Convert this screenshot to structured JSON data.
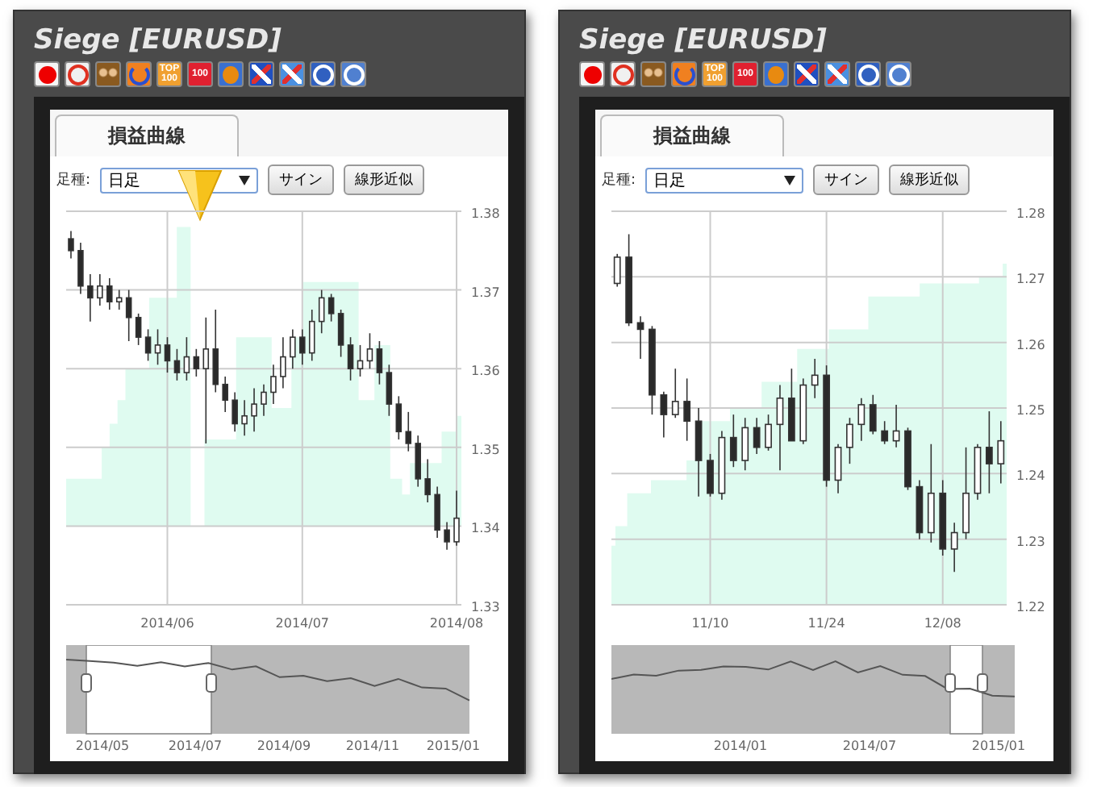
{
  "panels": [
    {
      "title": "Siege [EURUSD]",
      "pointer_marker": true,
      "icons": [
        {
          "kind": "red-dot"
        },
        {
          "kind": "swirl"
        },
        {
          "kind": "people"
        },
        {
          "kind": "arrow"
        },
        {
          "kind": "top",
          "label": "TOP 100"
        },
        {
          "kind": "t100",
          "label": "100"
        },
        {
          "kind": "egg"
        },
        {
          "kind": "network"
        },
        {
          "kind": "leaf"
        },
        {
          "kind": "gauge"
        },
        {
          "kind": "globe"
        }
      ],
      "tabs": [
        {
          "label": "損益曲線",
          "selected": true
        }
      ],
      "timeframe": {
        "label": "足種:",
        "value": "日足"
      },
      "buttons": [
        "サイン",
        "線形近似"
      ],
      "chart_data": {
        "type": "candlestick",
        "categories": [
          null,
          null,
          null,
          null,
          null,
          null,
          null,
          null,
          null,
          null,
          "2014/06",
          null,
          null,
          null,
          null,
          null,
          null,
          null,
          null,
          null,
          null,
          null,
          null,
          null,
          "2014/07",
          null,
          null,
          null,
          null,
          null,
          null,
          null,
          null,
          null,
          null,
          null,
          null,
          null,
          null,
          null,
          "2014/08"
        ],
        "ohlc": [
          [
            1.3765,
            1.3775,
            1.374,
            1.375
          ],
          [
            1.375,
            1.376,
            1.3695,
            1.3705
          ],
          [
            1.3705,
            1.372,
            1.366,
            1.369
          ],
          [
            1.369,
            1.372,
            1.368,
            1.3705
          ],
          [
            1.3705,
            1.3715,
            1.3675,
            1.3685
          ],
          [
            1.3685,
            1.37,
            1.3675,
            1.369
          ],
          [
            1.369,
            1.37,
            1.3635,
            1.3665
          ],
          [
            1.3665,
            1.367,
            1.363,
            1.364
          ],
          [
            1.364,
            1.365,
            1.361,
            1.362
          ],
          [
            1.362,
            1.365,
            1.3605,
            1.363
          ],
          [
            1.363,
            1.364,
            1.3595,
            1.361
          ],
          [
            1.361,
            1.3625,
            1.3585,
            1.3595
          ],
          [
            1.3595,
            1.364,
            1.3585,
            1.3615
          ],
          [
            1.3615,
            1.3625,
            1.359,
            1.36
          ],
          [
            1.36,
            1.3665,
            1.3505,
            1.3625
          ],
          [
            1.3625,
            1.3675,
            1.357,
            1.358
          ],
          [
            1.358,
            1.359,
            1.3545,
            1.356
          ],
          [
            1.356,
            1.357,
            1.352,
            1.353
          ],
          [
            1.353,
            1.356,
            1.3515,
            1.354
          ],
          [
            1.354,
            1.3575,
            1.352,
            1.3555
          ],
          [
            1.3555,
            1.358,
            1.354,
            1.357
          ],
          [
            1.357,
            1.3605,
            1.3555,
            1.359
          ],
          [
            1.359,
            1.364,
            1.3575,
            1.3615
          ],
          [
            1.3615,
            1.365,
            1.36,
            1.364
          ],
          [
            1.364,
            1.365,
            1.3605,
            1.362
          ],
          [
            1.362,
            1.3675,
            1.361,
            1.366
          ],
          [
            1.366,
            1.37,
            1.3645,
            1.369
          ],
          [
            1.369,
            1.3695,
            1.366,
            1.367
          ],
          [
            1.367,
            1.3675,
            1.3615,
            1.363
          ],
          [
            1.363,
            1.364,
            1.3585,
            1.36
          ],
          [
            1.36,
            1.363,
            1.359,
            1.361
          ],
          [
            1.361,
            1.3645,
            1.36,
            1.3625
          ],
          [
            1.3625,
            1.3635,
            1.358,
            1.3595
          ],
          [
            1.3595,
            1.3605,
            1.354,
            1.3555
          ],
          [
            1.3555,
            1.3565,
            1.351,
            1.352
          ],
          [
            1.352,
            1.3545,
            1.3495,
            1.3505
          ],
          [
            1.3505,
            1.3515,
            1.345,
            1.346
          ],
          [
            1.346,
            1.3485,
            1.343,
            1.344
          ],
          [
            1.344,
            1.345,
            1.3385,
            1.3395
          ],
          [
            1.3395,
            1.3405,
            1.337,
            1.338
          ],
          [
            1.338,
            1.3445,
            1.3375,
            1.341
          ]
        ],
        "ylim": [
          1.33,
          1.38
        ],
        "grid": true,
        "yticks": [
          {
            "value": 1.38,
            "label": "1.38"
          },
          {
            "value": 1.37,
            "label": "1.37"
          },
          {
            "value": 1.36,
            "label": "1.36"
          },
          {
            "value": 1.35,
            "label": "1.35"
          },
          {
            "value": 1.34,
            "label": "1.34"
          },
          {
            "value": 1.33,
            "label": "1.33"
          }
        ]
      },
      "navigator_labels": [
        "2014/05",
        "2014/07",
        "2014/09",
        "2014/11",
        "2015/01"
      ]
    },
    {
      "title": "Siege [EURUSD]",
      "icons": [
        {
          "kind": "smile"
        },
        {
          "kind": "swirl"
        },
        {
          "kind": "people"
        },
        {
          "kind": "arrow"
        },
        {
          "kind": "top",
          "label": "TOP 100"
        },
        {
          "kind": "t100",
          "label": "100"
        },
        {
          "kind": "egg"
        },
        {
          "kind": "network"
        },
        {
          "kind": "leaf"
        },
        {
          "kind": "gauge"
        },
        {
          "kind": "globe"
        }
      ],
      "tabs": [
        {
          "label": "損益曲線",
          "selected": true
        }
      ],
      "timeframe": {
        "label": "足種:",
        "value": "日足"
      },
      "buttons": [
        "サイン",
        "線形近似"
      ],
      "chart_data": {
        "type": "candlestick",
        "categories": [
          null,
          null,
          null,
          null,
          null,
          null,
          null,
          null,
          "11/10",
          null,
          null,
          null,
          null,
          null,
          null,
          null,
          null,
          null,
          "11/24",
          null,
          null,
          null,
          null,
          null,
          null,
          null,
          null,
          null,
          "12/08",
          null,
          null,
          null,
          null,
          null
        ],
        "ohlc": [
          [
            1.269,
            1.2735,
            1.2685,
            1.273
          ],
          [
            1.273,
            1.2765,
            1.2625,
            1.263
          ],
          [
            1.263,
            1.264,
            1.2575,
            1.262
          ],
          [
            1.262,
            1.2625,
            1.249,
            1.252
          ],
          [
            1.252,
            1.2525,
            1.2455,
            1.249
          ],
          [
            1.249,
            1.256,
            1.2485,
            1.251
          ],
          [
            1.251,
            1.2545,
            1.245,
            1.248
          ],
          [
            1.248,
            1.25,
            1.2365,
            1.242
          ],
          [
            1.242,
            1.243,
            1.2365,
            1.237
          ],
          [
            1.237,
            1.2465,
            1.236,
            1.2455
          ],
          [
            1.2455,
            1.249,
            1.241,
            1.242
          ],
          [
            1.242,
            1.2485,
            1.2405,
            1.247
          ],
          [
            1.247,
            1.2485,
            1.243,
            1.244
          ],
          [
            1.244,
            1.249,
            1.2435,
            1.2475
          ],
          [
            1.2475,
            1.2535,
            1.2405,
            1.2515
          ],
          [
            1.2515,
            1.256,
            1.245,
            1.245
          ],
          [
            1.245,
            1.2545,
            1.2445,
            1.2535
          ],
          [
            1.2535,
            1.2575,
            1.2515,
            1.255
          ],
          [
            1.255,
            1.2565,
            1.238,
            1.239
          ],
          [
            1.239,
            1.2445,
            1.237,
            1.244
          ],
          [
            1.244,
            1.2485,
            1.2415,
            1.2475
          ],
          [
            1.2475,
            1.2515,
            1.245,
            1.2505
          ],
          [
            1.2505,
            1.252,
            1.246,
            1.2465
          ],
          [
            1.2465,
            1.248,
            1.2445,
            1.245
          ],
          [
            1.245,
            1.2505,
            1.244,
            1.2465
          ],
          [
            1.2465,
            1.247,
            1.2375,
            1.238
          ],
          [
            1.238,
            1.239,
            1.23,
            1.231
          ],
          [
            1.231,
            1.2445,
            1.2295,
            1.237
          ],
          [
            1.237,
            1.239,
            1.2275,
            1.2285
          ],
          [
            1.2285,
            1.2325,
            1.225,
            1.231
          ],
          [
            1.231,
            1.244,
            1.23,
            1.237
          ],
          [
            1.237,
            1.2445,
            1.236,
            1.244
          ],
          [
            1.244,
            1.2495,
            1.237,
            1.2415
          ],
          [
            1.2415,
            1.248,
            1.2385,
            1.245
          ]
        ],
        "ylim": [
          1.22,
          1.28
        ],
        "grid": true,
        "yticks": [
          {
            "value": 1.28,
            "label": "1.28"
          },
          {
            "value": 1.27,
            "label": "1.27"
          },
          {
            "value": 1.26,
            "label": "1.26"
          },
          {
            "value": 1.25,
            "label": "1.25"
          },
          {
            "value": 1.24,
            "label": "1.24"
          },
          {
            "value": 1.23,
            "label": "1.23"
          },
          {
            "value": 1.22,
            "label": "1.22"
          }
        ]
      },
      "navigator_labels": [
        "2014/01",
        "2014/07",
        "2015/01"
      ]
    }
  ]
}
